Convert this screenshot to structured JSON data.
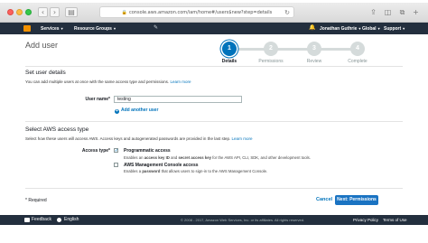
{
  "browser": {
    "url": "console.aws.amazon.com/iam/home#/users$new?step=details"
  },
  "topnav": {
    "services": "Services",
    "resource_groups": "Resource Groups",
    "user": "Jonathan Guthrie",
    "region": "Global",
    "support": "Support"
  },
  "page": {
    "title": "Add user",
    "steps": [
      {
        "number": "1",
        "label": "Details"
      },
      {
        "number": "2",
        "label": "Permissions"
      },
      {
        "number": "3",
        "label": "Review"
      },
      {
        "number": "4",
        "label": "Complete"
      }
    ],
    "active_step": 1
  },
  "user_details": {
    "heading": "Set user details",
    "description": "You can add multiple users at once with the same access type and permissions.",
    "learn_more": "Learn more",
    "user_name_label": "User name*",
    "user_name_value": "testing",
    "add_another": "Add another user"
  },
  "access_type": {
    "heading": "Select AWS access type",
    "description": "Select how these users will access AWS. Access keys and autogenerated passwords are provided in the last step.",
    "learn_more": "Learn more",
    "label": "Access type*",
    "options": [
      {
        "title": "Programmatic access",
        "desc_pre": "Enables an ",
        "desc_b1": "access key ID",
        "desc_mid": " and ",
        "desc_b2": "secret access key",
        "desc_post": " for the AWS API, CLI, SDK, and other development tools.",
        "checked": true
      },
      {
        "title": "AWS Management Console access",
        "desc_pre": "Enables a ",
        "desc_b1": "password",
        "desc_post": " that allows users to sign-in to the AWS Management Console.",
        "checked": false
      }
    ]
  },
  "footer": {
    "required": "* Required",
    "cancel": "Cancel",
    "next": "Next: Permissions"
  },
  "bottombar": {
    "feedback": "Feedback",
    "language": "English",
    "copyright": "© 2008 - 2017, Amazon Web Services, Inc. or its affiliates. All rights reserved.",
    "privacy": "Privacy Policy",
    "terms": "Terms of Use"
  }
}
